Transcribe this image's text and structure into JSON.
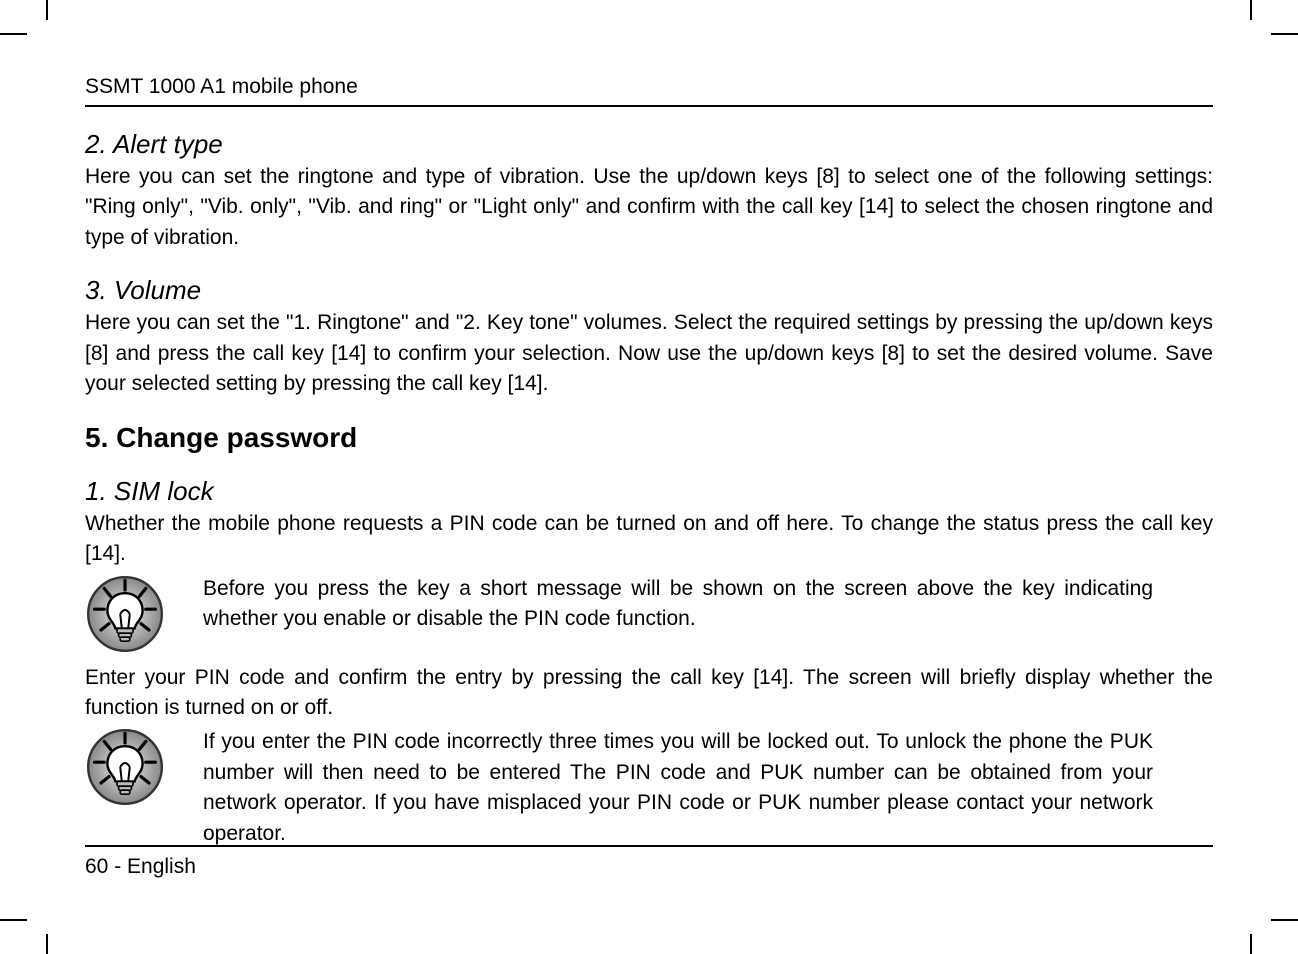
{
  "header": {
    "title": "SSMT 1000 A1 mobile phone"
  },
  "sections": {
    "alert": {
      "heading": "2. Alert type",
      "body": "Here you can set the ringtone and type of vibration. Use the up/down keys [8] to select one of the following settings: \"Ring only\", \"Vib. only\", \"Vib. and ring\" or \"Light only\" and confirm with the call key [14] to select the chosen ringtone and type of vibration."
    },
    "volume": {
      "heading": "3. Volume",
      "body": "Here you can set the \"1. Ringtone\" and \"2. Key tone\" volumes. Select the required settings by pressing the up/down keys [8] and press the call key [14] to confirm your selection. Now use the up/down keys [8] to set the desired volume. Save your selected setting by pressing the call key [14]."
    },
    "changepw": {
      "heading": "5. Change password",
      "sim": {
        "heading": "1. SIM lock",
        "body1": "Whether the mobile phone requests a PIN code can be turned on and off here. To change the status press the call key [14].",
        "note1": "Before you press the key a short message will be shown on the screen above the key indicating whether you enable or disable the PIN code function.",
        "body2": "Enter your PIN code and confirm the entry by pressing the call key [14]. The screen will briefly display whether the function is turned on or off.",
        "note2": "If you enter the PIN code incorrectly three times you will be locked out. To unlock the phone the PUK number will then need to be entered The PIN code and PUK number can be obtained from your network operator. If you have misplaced your PIN code or PUK number please contact your network operator."
      }
    }
  },
  "footer": {
    "page": "60",
    "sep": " -  ",
    "lang": "English"
  }
}
